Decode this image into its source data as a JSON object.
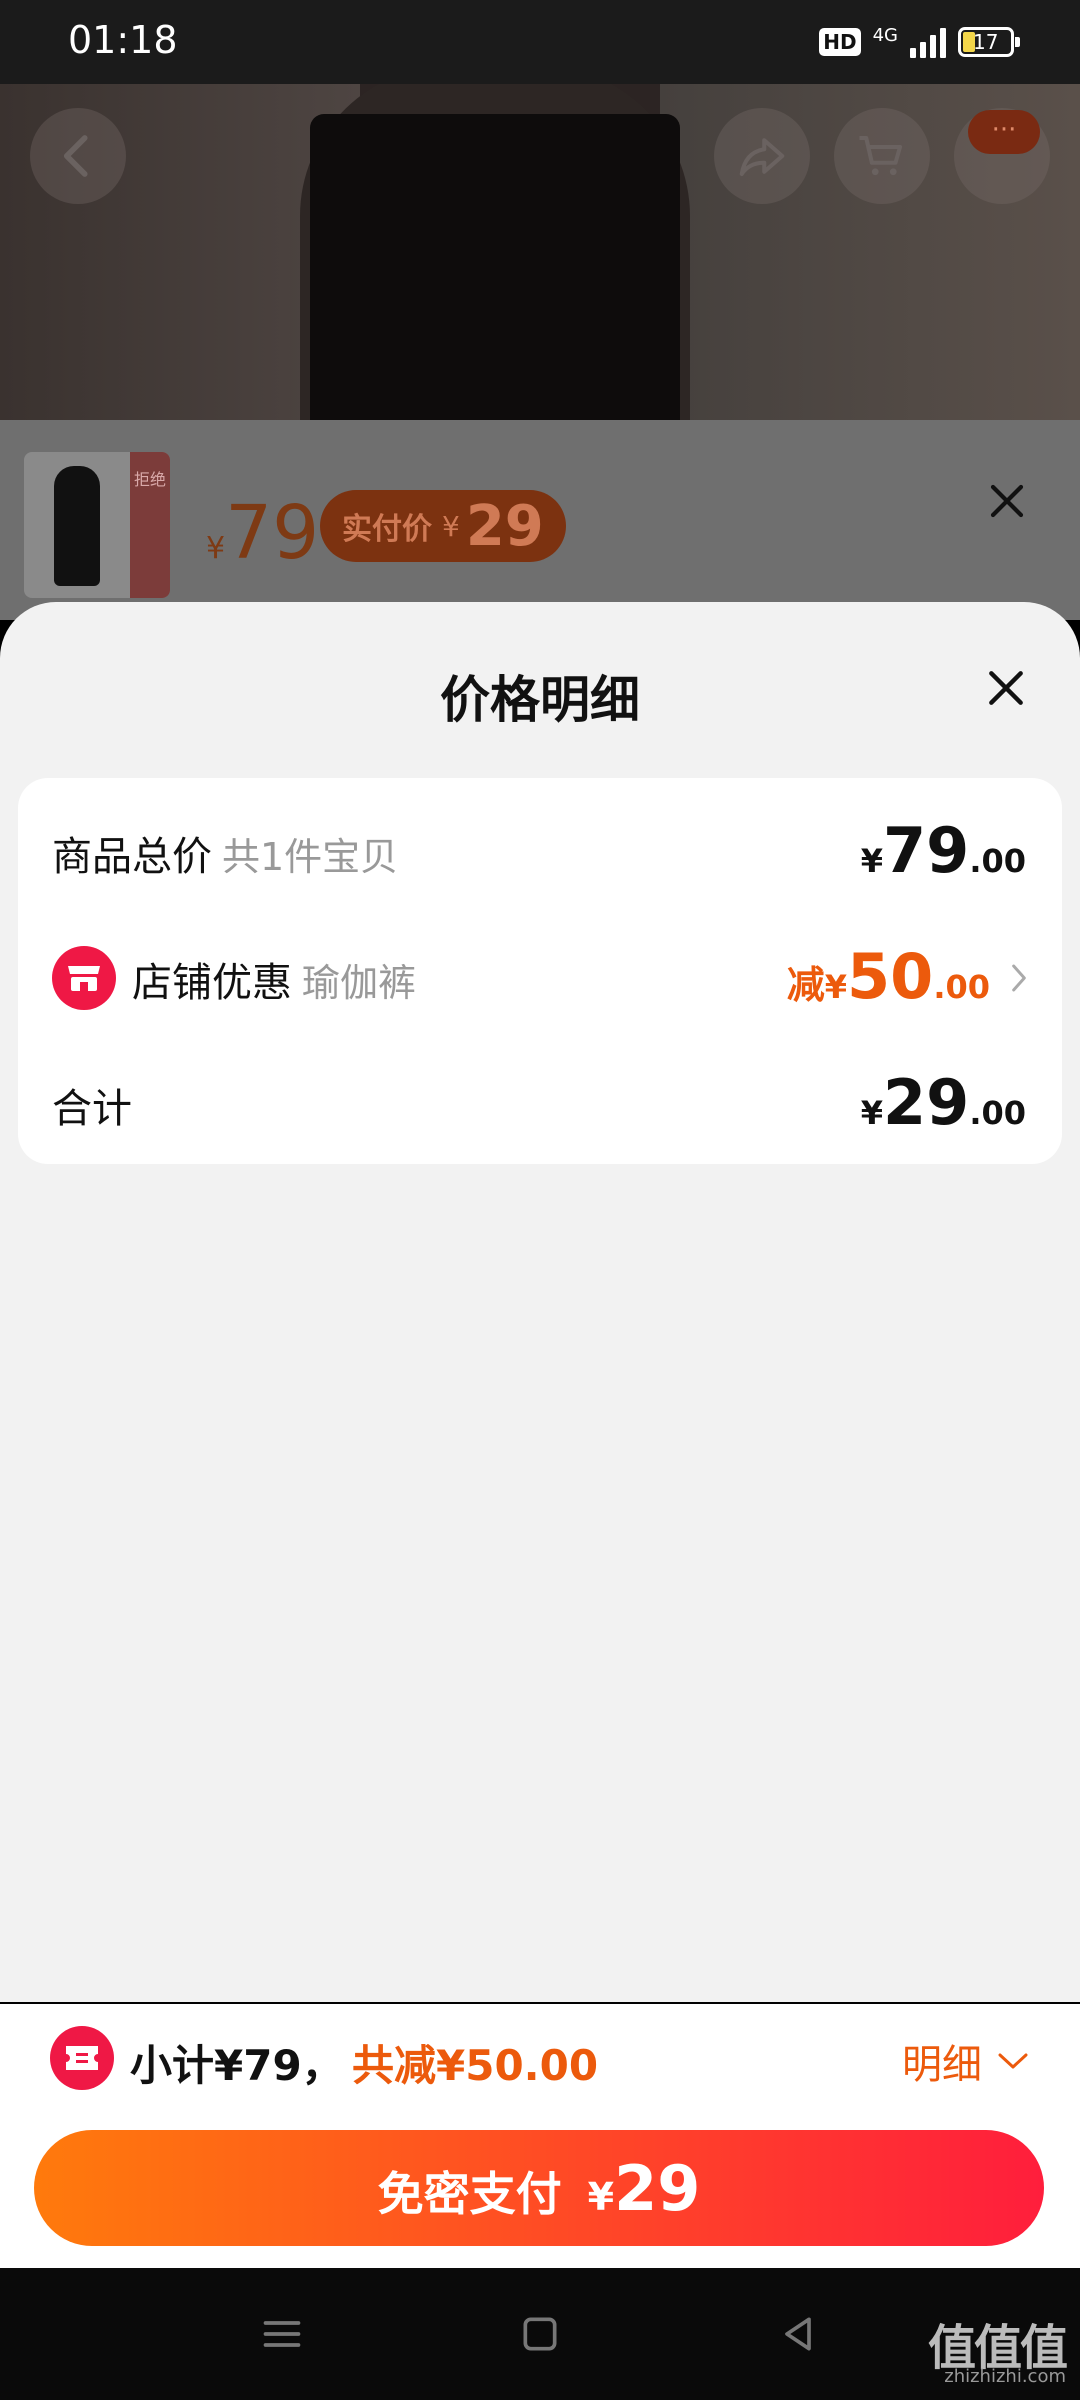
{
  "status_bar": {
    "time": "01:18",
    "hd": "HD",
    "network": "4G",
    "battery": "17"
  },
  "product_preview": {
    "thumb_tag": "拒绝",
    "price_symbol": "¥",
    "price": "79",
    "actual_pay_label": "实付价",
    "actual_pay_symbol": "¥",
    "actual_pay_value": "29",
    "menu_dots": "···"
  },
  "sheet": {
    "title": "价格明细",
    "rows": [
      {
        "label": "商品总价",
        "sub": "共1件宝贝",
        "symbol": "¥",
        "int": "79",
        "dec": ".00"
      },
      {
        "label": "店铺优惠",
        "sub": "瑜伽裤",
        "prefix": "减",
        "symbol": "¥",
        "int": "50",
        "dec": ".00"
      },
      {
        "label": "合计",
        "symbol": "¥",
        "int": "29",
        "dec": ".00"
      }
    ]
  },
  "footer": {
    "subtotal": "小计¥79，",
    "saved": "共减¥50.00",
    "detail": "明细",
    "pay_label": "免密支付",
    "pay_symbol": "¥",
    "pay_value": "29"
  },
  "watermark": {
    "text": "值值值",
    "site": "zhizhizhi.com"
  },
  "colors": {
    "accent_orange": "#ec5a0c",
    "brand_red": "#ef1845",
    "gradient_start": "#ff7a0c",
    "gradient_end": "#ff1e3c"
  }
}
